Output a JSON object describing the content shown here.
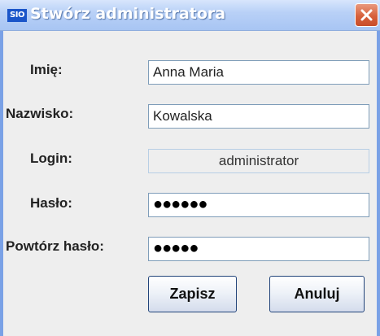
{
  "window": {
    "icon_text": "SIO",
    "title": "Stwórz administratora"
  },
  "form": {
    "imie_label": "Imię:",
    "imie_value": "Anna Maria",
    "nazwisko_label": "Nazwisko:",
    "nazwisko_value": "Kowalska",
    "login_label": "Login:",
    "login_value": "administrator",
    "haslo_label": "Hasło:",
    "haslo_mask": "●●●●●●",
    "powtorz_label": "Powtórz hasło:",
    "powtorz_mask": "●●●●●"
  },
  "buttons": {
    "save_label": "Zapisz",
    "cancel_label": "Anuluj"
  },
  "colors": {
    "titlebar": "#b9d1f7",
    "close_button": "#d7613c",
    "window_background": "#eeeeee",
    "field_border": "#7f9db9"
  },
  "icons": {
    "app": "sio-logo-icon",
    "close": "close-icon"
  }
}
